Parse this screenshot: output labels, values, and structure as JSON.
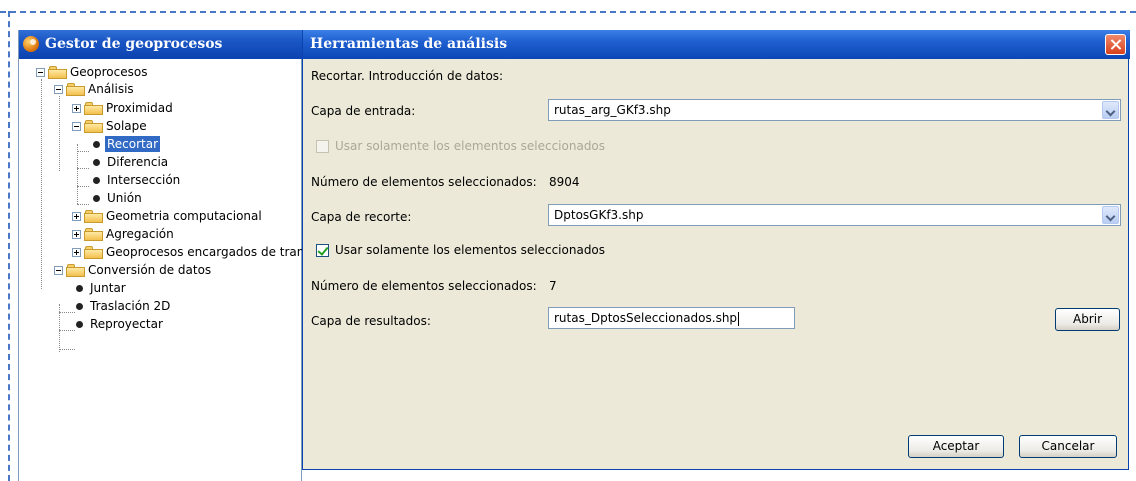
{
  "left_window": {
    "title": "Gestor de geoprocesos",
    "tree": {
      "root": "Geoprocesos",
      "analisis": "Análisis",
      "proximidad": "Proximidad",
      "solape": "Solape",
      "recortar": "Recortar",
      "diferencia": "Diferencia",
      "interseccion": "Intersección",
      "union": "Unión",
      "geometria": "Geometria computacional",
      "agregacion": "Agregación",
      "encargados": "Geoprocesos encargados de tran",
      "conversion": "Conversión de datos",
      "juntar": "Juntar",
      "traslacion": "Traslación 2D",
      "reproyectar": "Reproyectar"
    }
  },
  "dialog": {
    "title": "Herramientas de análisis",
    "heading": "Recortar. Introducción de datos:",
    "input_layer_label": "Capa de entrada:",
    "input_layer_value": "rutas_arg_GKf3.shp",
    "input_selected_only": "Usar solamente los elementos seleccionados",
    "input_count_label": "Número de elementos seleccionados:",
    "input_count_value": "8904",
    "clip_layer_label": "Capa de recorte:",
    "clip_layer_value": "DptosGKf3.shp",
    "clip_selected_only": "Usar solamente los elementos seleccionados",
    "clip_count_label": "Número de elementos seleccionados:",
    "clip_count_value": "7",
    "result_layer_label": "Capa de resultados:",
    "result_layer_value": "rutas_DptosSeleccionados.shp",
    "open_button": "Abrir",
    "accept_button": "Aceptar",
    "cancel_button": "Cancelar"
  },
  "colors": {
    "title_bar": "#1a55c4",
    "selection": "#316ac5",
    "dialog_bg": "#ece9d8",
    "frame_dash": "#4a78c8"
  }
}
